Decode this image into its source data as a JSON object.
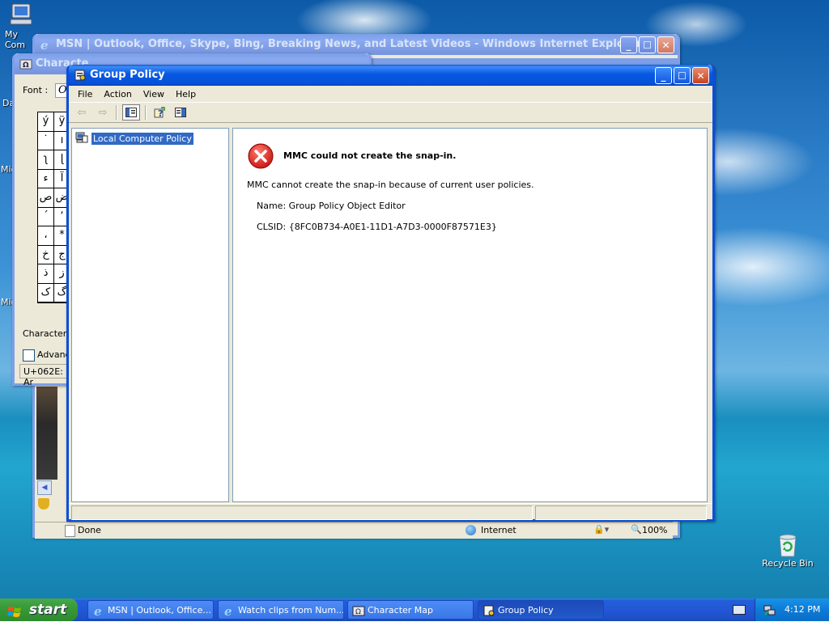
{
  "desktop": {
    "icons": [
      {
        "label": "My Com",
        "icon": "my-computer-icon"
      },
      {
        "label": "Recycle Bin",
        "icon": "recycle-bin-icon"
      }
    ],
    "side_labels": [
      "Da",
      "Mic",
      "Mic"
    ]
  },
  "ie_window": {
    "title": "MSN | Outlook, Office, Skype, Bing, Breaking News, and Latest Videos - Windows Internet Explorer",
    "status_text": "Done",
    "zone": "Internet",
    "zoom": "100%"
  },
  "charmap_window": {
    "title": "Characte",
    "font_label": "Font :",
    "font_value": "O",
    "grid": [
      [
        "ý",
        "ÿ"
      ],
      [
        "˙",
        "ı"
      ],
      [
        "ʅ",
        "ɭ"
      ],
      [
        "ء",
        "آ"
      ],
      [
        "ص",
        "ض"
      ],
      [
        "ˊ",
        "ʼ"
      ],
      [
        "،",
        "*"
      ],
      [
        "خ",
        "ج"
      ],
      [
        "ذ",
        "ز"
      ],
      [
        "ک",
        "گ"
      ]
    ],
    "chars_label": "Characters",
    "advanced_label": "Advanc",
    "status": "U+062E: Ar"
  },
  "mmc": {
    "title": "Group Policy",
    "menu": [
      "File",
      "Action",
      "View",
      "Help"
    ],
    "tree_root": "Local Computer Policy",
    "error": {
      "heading": "MMC could not create the snap-in.",
      "message": "MMC cannot create the snap-in because of current user policies.",
      "name_line": "Name: Group Policy Object Editor",
      "clsid_line": "CLSID: {8FC0B734-A0E1-11D1-A7D3-0000F87571E3}"
    }
  },
  "taskbar": {
    "start_label": "start",
    "tasks": [
      {
        "label": "MSN | Outlook, Office...",
        "icon": "ie-icon"
      },
      {
        "label": "Watch clips from Num...",
        "icon": "ie-icon"
      },
      {
        "label": "Character Map",
        "icon": "charmap-icon"
      },
      {
        "label": "Group Policy",
        "icon": "mmc-icon"
      }
    ],
    "clock": "4:12 PM"
  },
  "colors": {
    "title_active": "#0758e3",
    "close_button": "#c8431d",
    "start_green": "#389a38",
    "error_red": "#d81e1e",
    "selection": "#316ac5"
  }
}
